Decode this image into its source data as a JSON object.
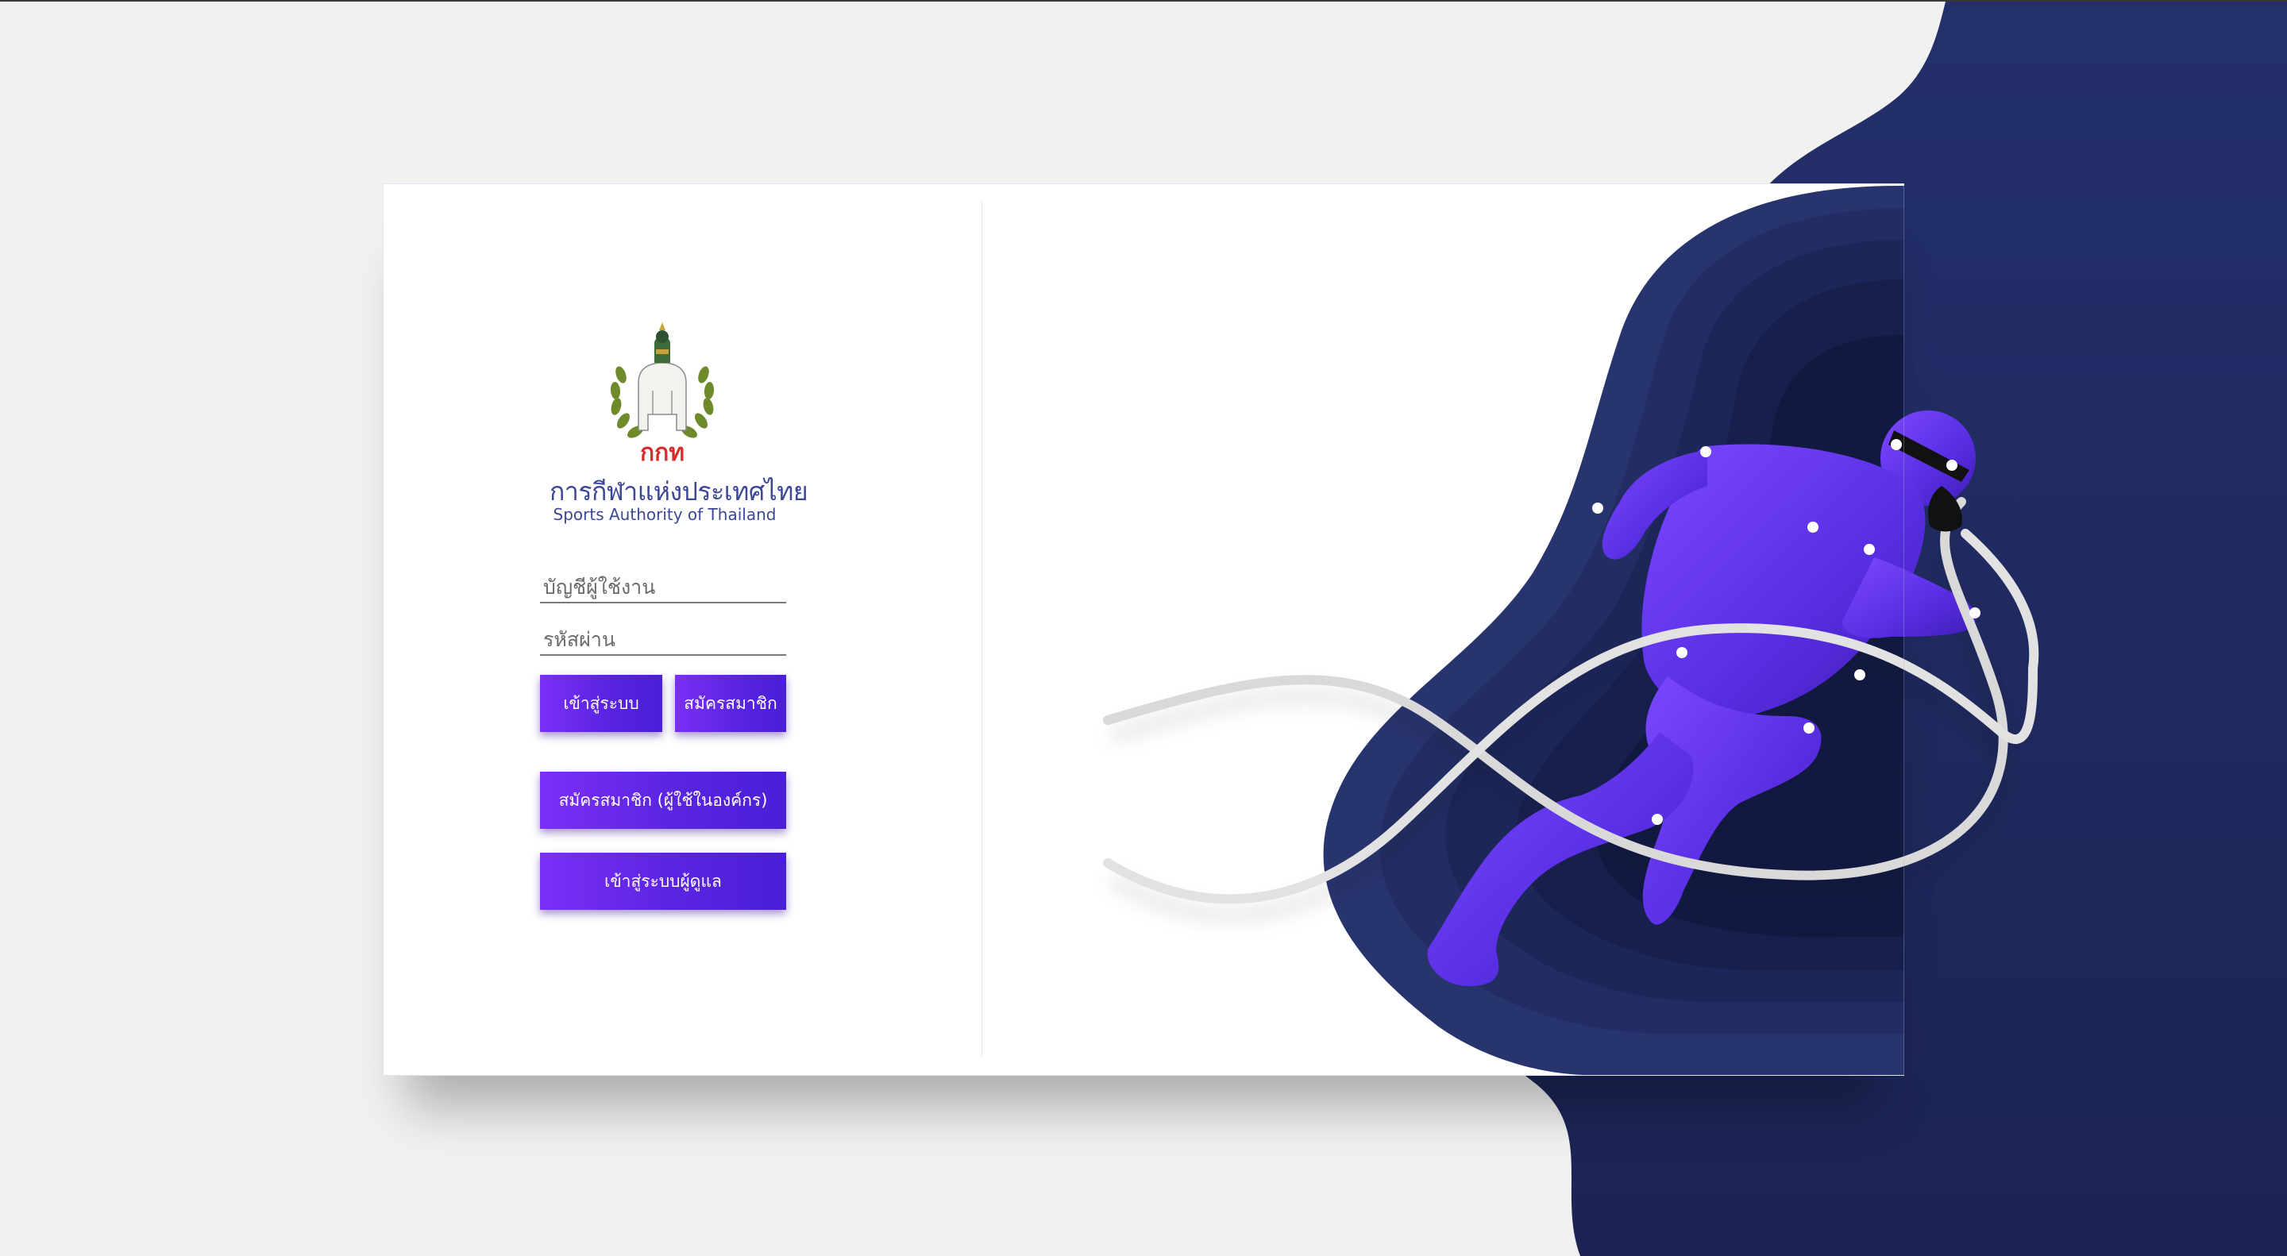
{
  "org": {
    "name_th": "การกีฬาแห่งประเทศไทย",
    "name_en": "Sports Authority of Thailand",
    "logo_letters": "กกท"
  },
  "login": {
    "username_placeholder": "บัญชีผู้ใช้งาน",
    "username_value": "",
    "password_placeholder": "รหัสผ่าน",
    "password_value": "",
    "login_button": "เข้าสู่ระบบ",
    "register_button": "สมัครสมาชิก",
    "register_internal_button": "สมัครสมาชิก (ผู้ใช้ในองค์กร)",
    "admin_login_button": "เข้าสู่ระบบผู้ดูแล"
  },
  "colors": {
    "page_bg": "#f1f1f1",
    "navy": "#1f2a5c",
    "button_start": "#7b2ff7",
    "button_end": "#4a1fd6",
    "brand_text": "#3c4796",
    "logo_red": "#d62e2e",
    "runner": "#6a35f0"
  },
  "icons": {
    "logo": "elephant-emblem-icon",
    "illustration": "running-athlete-illustration"
  }
}
